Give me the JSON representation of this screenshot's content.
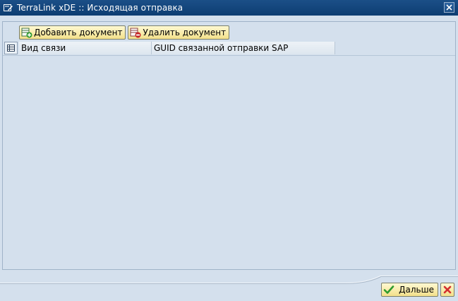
{
  "window": {
    "title": "TerraLink xDE :: Исходящая отправка",
    "title_icon": "window-edit-icon",
    "close_icon": "close-icon"
  },
  "toolbar": {
    "add_label": "Добавить документ",
    "add_icon": "add-row-icon",
    "remove_label": "Удалить документ",
    "remove_icon": "remove-row-icon"
  },
  "table": {
    "select_all_icon": "select-all-icon",
    "columns": [
      "Вид связи",
      "GUID связанной отправки SAP"
    ],
    "rows": []
  },
  "footer": {
    "ok_label": "Дальше",
    "ok_icon": "checkmark-icon",
    "cancel_icon": "cancel-icon"
  },
  "colors": {
    "titlebar": "#0d3d72",
    "background": "#d4e0ed",
    "button": "#f3e08a"
  }
}
